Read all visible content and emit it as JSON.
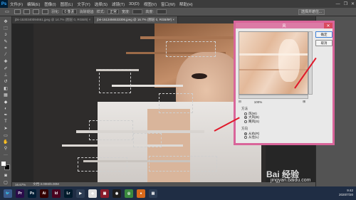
{
  "menubar": {
    "logo": "Ps",
    "items": [
      "文件(F)",
      "编辑(E)",
      "图像(I)",
      "图层(L)",
      "文字(Y)",
      "选择(S)",
      "滤镜(T)",
      "3D(D)",
      "视图(V)",
      "窗口(W)",
      "帮助(H)"
    ],
    "window_controls": [
      "—",
      "❐",
      "✕"
    ]
  },
  "options": {
    "feather_label": "羽化:",
    "feather_value": "0 像素",
    "antialias_label": "消除锯齿",
    "style_label": "样式:",
    "style_value": "正常",
    "width_label": "宽度:",
    "height_label": "高度:",
    "refine_button": "选择并遮住..."
  },
  "tabs": [
    {
      "label": "jbk-1530340094661.jpeg @ 14.7% (图层 0, RGB/8) ×"
    },
    {
      "label": "jbk-1513456533306.jpeg @ 16.7% (图层 0, RGB/8#) × "
    }
  ],
  "status": {
    "zoom": "16.67%",
    "doc": "文档:3.00M/6.00M"
  },
  "dialog": {
    "title": "风",
    "close": "✕",
    "ok_label": "确定",
    "cancel_label": "取消",
    "zoom_value": "100%",
    "zoom_minus": "⊟",
    "zoom_plus": "⊞",
    "method_title": "方法",
    "methods": [
      {
        "label": "风(W)",
        "selected": false
      },
      {
        "label": "大风(B)",
        "selected": true
      },
      {
        "label": "飓风(S)",
        "selected": false
      }
    ],
    "direction_title": "方向",
    "directions": [
      {
        "label": "从右(R)",
        "selected": true
      },
      {
        "label": "从左(L)",
        "selected": false
      }
    ]
  },
  "taskbar": {
    "apps": [
      {
        "name": "start-icon",
        "glyph": "🐦",
        "color": "#3a5a8c"
      },
      {
        "name": "premiere-icon",
        "glyph": "Pr",
        "color": "#2a0c4a"
      },
      {
        "name": "photoshop-icon",
        "glyph": "Ps",
        "color": "#001d34"
      },
      {
        "name": "illustrator-icon",
        "glyph": "Ai",
        "color": "#330000"
      },
      {
        "name": "indesign-icon",
        "glyph": "Id",
        "color": "#49021f"
      },
      {
        "name": "lightroom-icon",
        "glyph": "Lr",
        "color": "#001a2b"
      },
      {
        "name": "media-icon",
        "glyph": "▶",
        "color": "#2e3e55"
      },
      {
        "name": "files-icon",
        "glyph": "◆",
        "color": "#e0e0e0"
      },
      {
        "name": "app-icon",
        "glyph": "▣",
        "color": "#8a1c2b"
      },
      {
        "name": "qq-icon",
        "glyph": "◉",
        "color": "#1d1d1d"
      },
      {
        "name": "chrome-icon",
        "glyph": "◎",
        "color": "#3b8a3e"
      },
      {
        "name": "firefox-icon",
        "glyph": "●",
        "color": "#d96a1b"
      },
      {
        "name": "pictures-icon",
        "glyph": "▤",
        "color": "#2e3e55"
      }
    ],
    "time": "9:42",
    "date": "2020/7/20"
  },
  "watermark": {
    "brand": "Bai 经验",
    "url": "jingyan.baidu.com"
  },
  "colors": {
    "dialog_border": "#d9659a",
    "arrow": "#e0192a",
    "ps_gray": "#535353"
  }
}
